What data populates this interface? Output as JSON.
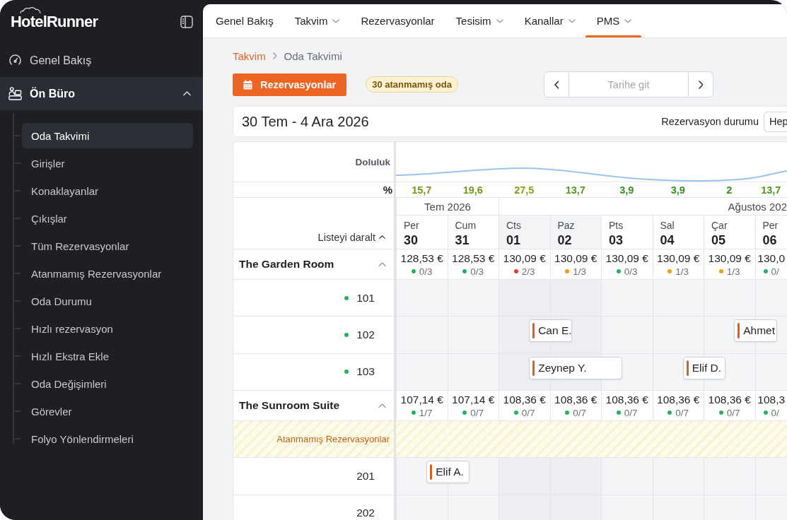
{
  "sidebar": {
    "logo": "HotelRunner",
    "items": [
      {
        "label": "Genel Bakış",
        "selected": false
      },
      {
        "label": "Ön Büro",
        "selected": true,
        "expanded": true,
        "children": [
          {
            "label": "Oda Takvimi",
            "selected": true
          },
          {
            "label": "Girişler",
            "selected": false
          },
          {
            "label": "Konaklayanlar",
            "selected": false
          },
          {
            "label": "Çıkışlar",
            "selected": false
          },
          {
            "label": "Tüm Rezervasyonlar",
            "selected": false
          },
          {
            "label": "Atanmamış Rezervasyonlar",
            "selected": false
          },
          {
            "label": "Oda Durumu",
            "selected": false
          },
          {
            "label": "Hızlı rezervasyon",
            "selected": false
          },
          {
            "label": "Hızlı Ekstra Ekle",
            "selected": false
          },
          {
            "label": "Oda Değişimleri",
            "selected": false
          },
          {
            "label": "Görevler",
            "selected": false
          },
          {
            "label": "Folyo Yönlendirmeleri",
            "selected": false
          }
        ]
      }
    ]
  },
  "top_nav": {
    "tabs": [
      {
        "label": "Genel Bakış",
        "dropdown": false,
        "selected": false
      },
      {
        "label": "Takvim",
        "dropdown": true,
        "selected": false
      },
      {
        "label": "Rezervasyonlar",
        "dropdown": false,
        "selected": false
      },
      {
        "label": "Tesisim",
        "dropdown": true,
        "selected": false
      },
      {
        "label": "Kanallar",
        "dropdown": true,
        "selected": false
      },
      {
        "label": "PMS",
        "dropdown": true,
        "selected": true
      }
    ]
  },
  "breadcrumb": [
    "Takvim",
    "Oda Takvimi"
  ],
  "toolbar": {
    "reservations_button": "Rezervasyonlar",
    "unassigned_badge": "30 atanmamış oda",
    "date_field": {
      "placeholder": "Tarihe git"
    }
  },
  "range_bar": {
    "title": "30 Tem - 4 Ara 2026",
    "status_label": "Rezervasyon durumu",
    "status_value": "Hep"
  },
  "calendar": {
    "occupancy_label": "Doluluk",
    "percent_label": "%",
    "occupancy": [
      {
        "value": "15,7",
        "color": "#6b9c14"
      },
      {
        "value": "19,6",
        "color": "#6b9c14"
      },
      {
        "value": "27,5",
        "color": "#8a9c14"
      },
      {
        "value": "13,7",
        "color": "#4f9a18"
      },
      {
        "value": "3,9",
        "color": "#36901c"
      },
      {
        "value": "3,9",
        "color": "#36901c"
      },
      {
        "value": "2",
        "color": "#36901c"
      },
      {
        "value": "13,7",
        "color": "#4f9a18"
      }
    ],
    "collapse_label": "Listeyi daralt",
    "months": [
      {
        "label": "Tem 2026",
        "days": [
          {
            "name": "Per",
            "date": "30",
            "weekend": false
          },
          {
            "name": "Cum",
            "date": "31",
            "weekend": false
          }
        ]
      },
      {
        "label": "Ağustos 202",
        "days": [
          {
            "name": "Cts",
            "date": "01",
            "weekend": true
          },
          {
            "name": "Paz",
            "date": "02",
            "weekend": true
          },
          {
            "name": "Pts",
            "date": "03",
            "weekend": false
          },
          {
            "name": "Sal",
            "date": "04",
            "weekend": false
          },
          {
            "name": "Çar",
            "date": "05",
            "weekend": false
          },
          {
            "name": "Per",
            "date": "06",
            "weekend": false
          }
        ]
      }
    ],
    "room_types": [
      {
        "name": "The Garden Room",
        "expanded": true,
        "rates": [
          {
            "price": "128,53 €",
            "availability": "0/3",
            "color": "#22b35e"
          },
          {
            "price": "128,53 €",
            "availability": "0/3",
            "color": "#22b35e"
          },
          {
            "price": "130,09 €",
            "availability": "2/3",
            "color": "#e53935"
          },
          {
            "price": "130,09 €",
            "availability": "1/3",
            "color": "#f59e0b"
          },
          {
            "price": "130,09 €",
            "availability": "0/3",
            "color": "#22b35e"
          },
          {
            "price": "130,09 €",
            "availability": "1/3",
            "color": "#f59e0b"
          },
          {
            "price": "130,09 €",
            "availability": "1/3",
            "color": "#f59e0b"
          },
          {
            "price": "130,0",
            "availability": "0/",
            "color": "#22b35e"
          }
        ],
        "rows": [
          {
            "kind": "room",
            "number": "101",
            "color": "#22b35e",
            "cells": [
              {
                "kind": "free"
              },
              {
                "kind": "free"
              },
              {
                "kind": "free"
              },
              {
                "kind": "free"
              },
              {
                "kind": "free"
              },
              {
                "kind": "free"
              },
              {
                "kind": "free"
              },
              {
                "kind": "free"
              }
            ]
          },
          {
            "kind": "room",
            "number": "102",
            "color": "#22b35e",
            "cells": [
              {
                "kind": "free"
              },
              {
                "kind": "free"
              },
              {
                "kind": "check_in",
                "guest": "Can E."
              },
              {
                "kind": "check_out"
              },
              {
                "kind": "free"
              },
              {
                "kind": "free"
              },
              {
                "kind": "check_in",
                "guest": "Ahmet"
              },
              {
                "kind": "check_out"
              }
            ]
          },
          {
            "kind": "room",
            "number": "103",
            "color": "#22b35e",
            "cells": [
              {
                "kind": "free"
              },
              {
                "kind": "free"
              },
              {
                "kind": "check_in",
                "guest": "Zeynep Y."
              },
              {
                "kind": "stay"
              },
              {
                "kind": "check_out"
              },
              {
                "kind": "check_in",
                "guest": "Elif D."
              },
              {
                "kind": "check_out"
              },
              {
                "kind": "free"
              }
            ]
          }
        ]
      },
      {
        "name": "The Sunroom Suite",
        "expanded": true,
        "rates": [
          {
            "price": "107,14 €",
            "availability": "1/7",
            "color": "#22b35e"
          },
          {
            "price": "107,14 €",
            "availability": "0/7",
            "color": "#22b35e"
          },
          {
            "price": "108,36 €",
            "availability": "0/7",
            "color": "#22b35e"
          },
          {
            "price": "108,36 €",
            "availability": "0/7",
            "color": "#22b35e"
          },
          {
            "price": "108,36 €",
            "availability": "0/7",
            "color": "#22b35e"
          },
          {
            "price": "108,36 €",
            "availability": "0/7",
            "color": "#22b35e"
          },
          {
            "price": "108,36 €",
            "availability": "0/7",
            "color": "#22b35e"
          },
          {
            "price": "108,3",
            "availability": "0/",
            "color": "#22b35e"
          }
        ],
        "rows": [
          {
            "kind": "unassigned",
            "label": "Atanmamış Rezervasyonlar"
          },
          {
            "kind": "room",
            "number": "201",
            "cells": [
              {
                "kind": "check_in",
                "guest": "Elif A."
              },
              {
                "kind": "check_out"
              },
              {
                "kind": "free"
              },
              {
                "kind": "free"
              },
              {
                "kind": "free"
              },
              {
                "kind": "free"
              },
              {
                "kind": "free"
              },
              {
                "kind": "free"
              }
            ]
          },
          {
            "kind": "room",
            "number": "202",
            "cells": [
              {
                "kind": "free"
              },
              {
                "kind": "free"
              },
              {
                "kind": "free"
              },
              {
                "kind": "free"
              },
              {
                "kind": "free"
              },
              {
                "kind": "free"
              },
              {
                "kind": "free"
              },
              {
                "kind": "free"
              }
            ]
          }
        ]
      }
    ]
  }
}
